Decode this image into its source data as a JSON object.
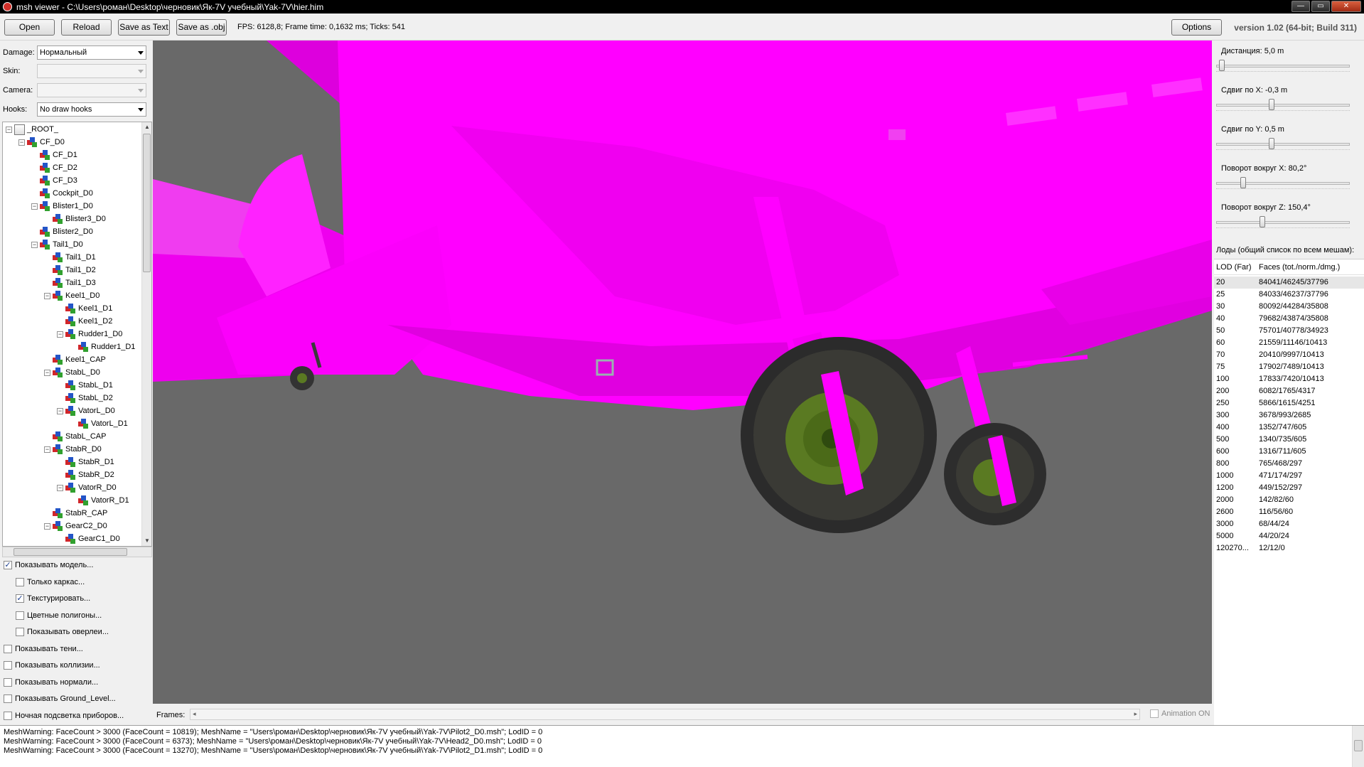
{
  "window": {
    "title": "msh viewer - C:\\Users\\роман\\Desktop\\черновик\\Як-7V учебный\\Yak-7V\\hier.him",
    "min_glyph": "—",
    "max_glyph": "▭",
    "close_glyph": "✕"
  },
  "toolbar": {
    "open_label": "Open",
    "reload_label": "Reload",
    "save_text_label": "Save as Text",
    "save_obj_label": "Save as .obj",
    "fps_text": "FPS: 6128,8; Frame time: 0,1632 ms; Ticks: 541",
    "options_label": "Options",
    "version": "version 1.02 (64-bit; Build 311)"
  },
  "left": {
    "damage": {
      "label": "Damage:",
      "value": "Нормальный"
    },
    "skin": {
      "label": "Skin:",
      "value": ""
    },
    "camera": {
      "label": "Camera:",
      "value": ""
    },
    "hooks": {
      "label": "Hooks:",
      "value": "No draw hooks"
    },
    "tree": [
      {
        "label": "_ROOT_",
        "level": 0,
        "expander": "⊟",
        "root": true
      },
      {
        "label": "CF_D0",
        "level": 1,
        "expander": "⊟"
      },
      {
        "label": "CF_D1",
        "level": 2,
        "expander": ""
      },
      {
        "label": "CF_D2",
        "level": 2,
        "expander": ""
      },
      {
        "label": "CF_D3",
        "level": 2,
        "expander": ""
      },
      {
        "label": "Cockpit_D0",
        "level": 2,
        "expander": ""
      },
      {
        "label": "Blister1_D0",
        "level": 2,
        "expander": "⊟"
      },
      {
        "label": "Blister3_D0",
        "level": 3,
        "expander": ""
      },
      {
        "label": "Blister2_D0",
        "level": 2,
        "expander": ""
      },
      {
        "label": "Tail1_D0",
        "level": 2,
        "expander": "⊟"
      },
      {
        "label": "Tail1_D1",
        "level": 3,
        "expander": ""
      },
      {
        "label": "Tail1_D2",
        "level": 3,
        "expander": ""
      },
      {
        "label": "Tail1_D3",
        "level": 3,
        "expander": ""
      },
      {
        "label": "Keel1_D0",
        "level": 3,
        "expander": "⊟"
      },
      {
        "label": "Keel1_D1",
        "level": 4,
        "expander": ""
      },
      {
        "label": "Keel1_D2",
        "level": 4,
        "expander": ""
      },
      {
        "label": "Rudder1_D0",
        "level": 4,
        "expander": "⊟"
      },
      {
        "label": "Rudder1_D1",
        "level": 5,
        "expander": ""
      },
      {
        "label": "Keel1_CAP",
        "level": 3,
        "expander": ""
      },
      {
        "label": "StabL_D0",
        "level": 3,
        "expander": "⊟"
      },
      {
        "label": "StabL_D1",
        "level": 4,
        "expander": ""
      },
      {
        "label": "StabL_D2",
        "level": 4,
        "expander": ""
      },
      {
        "label": "VatorL_D0",
        "level": 4,
        "expander": "⊟"
      },
      {
        "label": "VatorL_D1",
        "level": 5,
        "expander": ""
      },
      {
        "label": "StabL_CAP",
        "level": 3,
        "expander": ""
      },
      {
        "label": "StabR_D0",
        "level": 3,
        "expander": "⊟"
      },
      {
        "label": "StabR_D1",
        "level": 4,
        "expander": ""
      },
      {
        "label": "StabR_D2",
        "level": 4,
        "expander": ""
      },
      {
        "label": "VatorR_D0",
        "level": 4,
        "expander": "⊟"
      },
      {
        "label": "VatorR_D1",
        "level": 5,
        "expander": ""
      },
      {
        "label": "StabR_CAP",
        "level": 3,
        "expander": ""
      },
      {
        "label": "GearC2_D0",
        "level": 3,
        "expander": "⊟"
      },
      {
        "label": "GearC1_D0",
        "level": 4,
        "expander": ""
      }
    ],
    "checkboxes": [
      {
        "label": "Показывать модель...",
        "checked": true,
        "indent": 0
      },
      {
        "label": "Только каркас...",
        "checked": false,
        "indent": 1
      },
      {
        "label": "Текстурировать...",
        "checked": true,
        "indent": 1
      },
      {
        "label": "Цветные полигоны...",
        "checked": false,
        "indent": 1
      },
      {
        "label": "Показывать оверлеи...",
        "checked": false,
        "indent": 1
      },
      {
        "label": "Показывать тени...",
        "checked": false,
        "indent": 0
      },
      {
        "label": "Показывать коллизии...",
        "checked": false,
        "indent": 0
      },
      {
        "label": "Показывать нормали...",
        "checked": false,
        "indent": 0
      },
      {
        "label": "Показывать Ground_Level...",
        "checked": false,
        "indent": 0
      },
      {
        "label": "Ночная подсветка приборов...",
        "checked": false,
        "indent": 0
      }
    ],
    "check_mark": "✓"
  },
  "frames": {
    "label": "Frames:",
    "left_arrow": "◂",
    "right_arrow": "▸",
    "animation_label": "Animation ON"
  },
  "right": {
    "sliders": [
      {
        "label": "Дистанция:  5,0 m",
        "fraction": 0.02
      },
      {
        "label": "Сдвиг по X:  -0,3 m",
        "fraction": 0.41
      },
      {
        "label": "Сдвиг по Y:  0,5 m",
        "fraction": 0.41
      },
      {
        "label": "Поворот вокруг X:  80,2°",
        "fraction": 0.19
      },
      {
        "label": "Поворот вокруг Z:  150,4°",
        "fraction": 0.34
      }
    ],
    "lods_title": "Лоды (общий список по всем мешам):",
    "lod_col": "LOD (Far)",
    "faces_col": "Faces (tot./norm./dmg.)",
    "lods": [
      {
        "lod": "20",
        "faces": "84041/46245/37796"
      },
      {
        "lod": "25",
        "faces": "84033/46237/37796"
      },
      {
        "lod": "30",
        "faces": "80092/44284/35808"
      },
      {
        "lod": "40",
        "faces": "79682/43874/35808"
      },
      {
        "lod": "50",
        "faces": "75701/40778/34923"
      },
      {
        "lod": "60",
        "faces": "21559/11146/10413"
      },
      {
        "lod": "70",
        "faces": "20410/9997/10413"
      },
      {
        "lod": "75",
        "faces": "17902/7489/10413"
      },
      {
        "lod": "100",
        "faces": "17833/7420/10413"
      },
      {
        "lod": "200",
        "faces": "6082/1765/4317"
      },
      {
        "lod": "250",
        "faces": "5866/1615/4251"
      },
      {
        "lod": "300",
        "faces": "3678/993/2685"
      },
      {
        "lod": "400",
        "faces": "1352/747/605"
      },
      {
        "lod": "500",
        "faces": "1340/735/605"
      },
      {
        "lod": "600",
        "faces": "1316/711/605"
      },
      {
        "lod": "800",
        "faces": "765/468/297"
      },
      {
        "lod": "1000",
        "faces": "471/174/297"
      },
      {
        "lod": "1200",
        "faces": "449/152/297"
      },
      {
        "lod": "2000",
        "faces": "142/82/60"
      },
      {
        "lod": "2600",
        "faces": "116/56/60"
      },
      {
        "lod": "3000",
        "faces": "68/44/24"
      },
      {
        "lod": "5000",
        "faces": "44/20/24"
      },
      {
        "lod": "120270...",
        "faces": "12/12/0"
      }
    ]
  },
  "log": [
    "MeshWarning: FaceCount > 3000 (FaceCount = 10819); MeshName = \"Users\\роман\\Desktop\\черновик\\Як-7V учебный\\Yak-7V\\Pilot2_D0.msh\"; LodID = 0",
    "MeshWarning: FaceCount > 3000 (FaceCount = 6373); MeshName = \"Users\\роман\\Desktop\\черновик\\Як-7V учебный\\Yak-7V\\Head2_D0.msh\"; LodID = 0",
    "MeshWarning: FaceCount > 3000 (FaceCount = 13270); MeshName = \"Users\\роман\\Desktop\\черновик\\Як-7V учебный\\Yak-7V\\Pilot2_D1.msh\"; LodID = 0"
  ],
  "colors": {
    "model": "#ff00ff",
    "viewport_bg": "#6a6a6a",
    "wheel_hub": "#5a7a22"
  }
}
